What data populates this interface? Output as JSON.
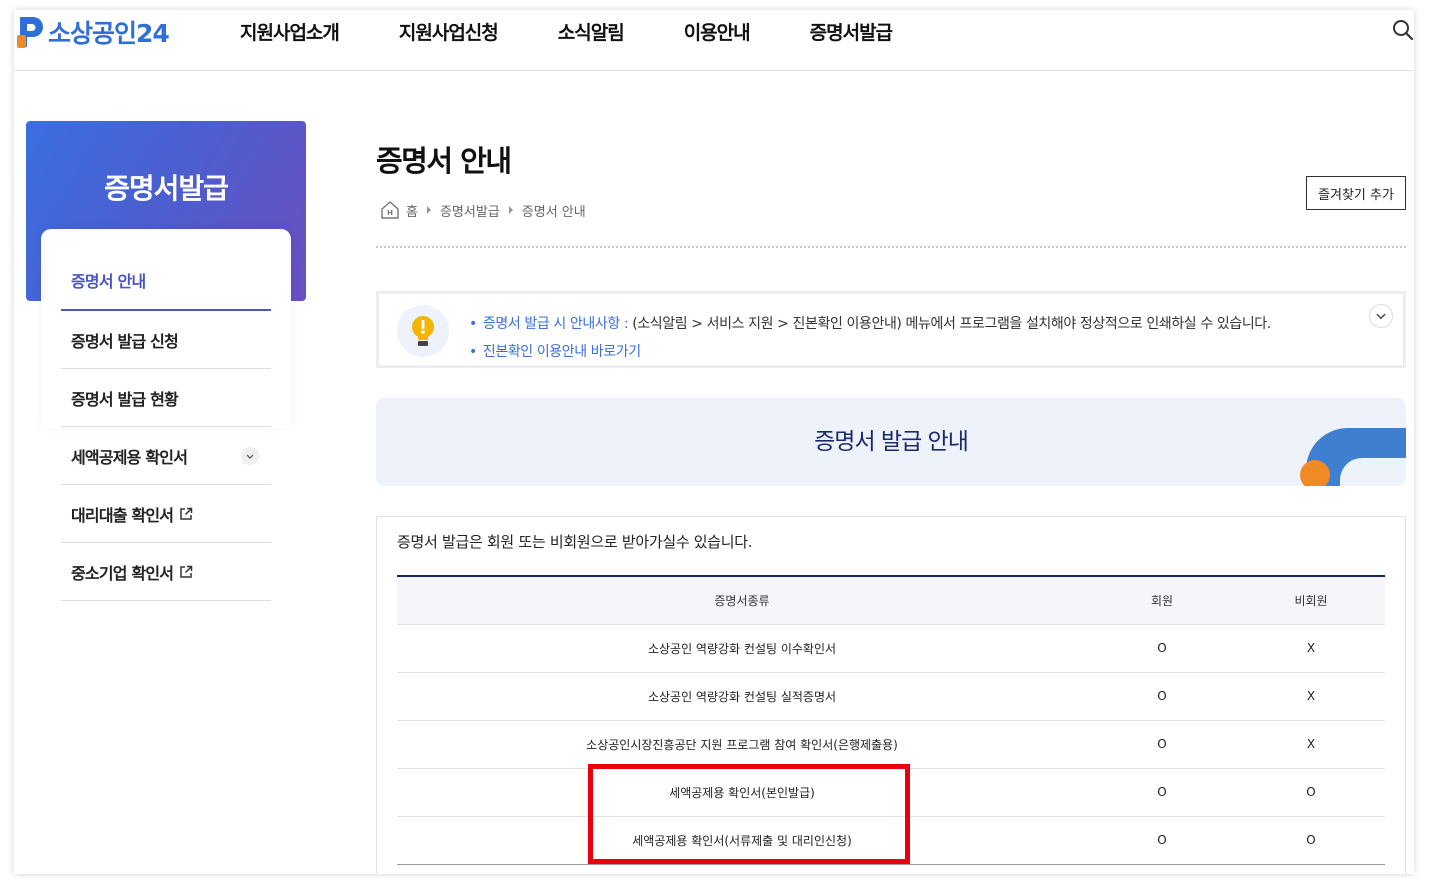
{
  "header": {
    "logo_text": "소상공인24",
    "nav": [
      "지원사업소개",
      "지원사업신청",
      "소식알림",
      "이용안내",
      "증명서발급"
    ],
    "search_icon": "search-icon"
  },
  "sidebar": {
    "title": "증명서발급",
    "items": [
      {
        "label": "증명서 안내",
        "active": true
      },
      {
        "label": "증명서 발급 신청"
      },
      {
        "label": "증명서 발급 현황"
      },
      {
        "label": "세액공제용 확인서",
        "icon": "chevron-down-icon"
      },
      {
        "label": "대리대출 확인서",
        "icon": "external-link-icon"
      },
      {
        "label": "중소기업 확인서",
        "icon": "external-link-icon"
      }
    ]
  },
  "main": {
    "title": "증명서 안내",
    "breadcrumb": [
      "홈",
      "증명서발급",
      "증명서 안내"
    ],
    "favorite_button": "즐겨찾기 추가",
    "notice": {
      "line1_link": "증명서 발급 시 안내사항 : ",
      "line1_text": "(소식알림 > 서비스 지원 > 진본확인 이용안내) 메뉴에서 프로그램을 설치해야 정상적으로 인쇄하실 수 있습니다.",
      "line2_link": "진본확인 이용안내 바로가기"
    },
    "banner_title": "증명서 발급 안내",
    "description": "증명서 발급은 회원 또는 비회원으로 받아가실수 있습니다.",
    "table": {
      "headers": [
        "증명서종류",
        "회원",
        "비회원"
      ],
      "rows": [
        [
          "소상공인 역량강화 컨설팅 이수확인서",
          "O",
          "X"
        ],
        [
          "소상공인 역량강화 컨설팅 실적증명서",
          "O",
          "X"
        ],
        [
          "소상공인시장진흥공단 지원 프로그램 참여 확인서(은행제출용)",
          "O",
          "X"
        ],
        [
          "세액공제용 확인서(본인발급)",
          "O",
          "O"
        ],
        [
          "세액공제용 확인서(서류제출 및 대리인신청)",
          "O",
          "O"
        ]
      ]
    }
  },
  "colors": {
    "brand_blue": "#2f6fd6",
    "accent_purple": "#4b56c4",
    "highlight_red": "#e8000e",
    "logo_orange": "#f08a24"
  }
}
